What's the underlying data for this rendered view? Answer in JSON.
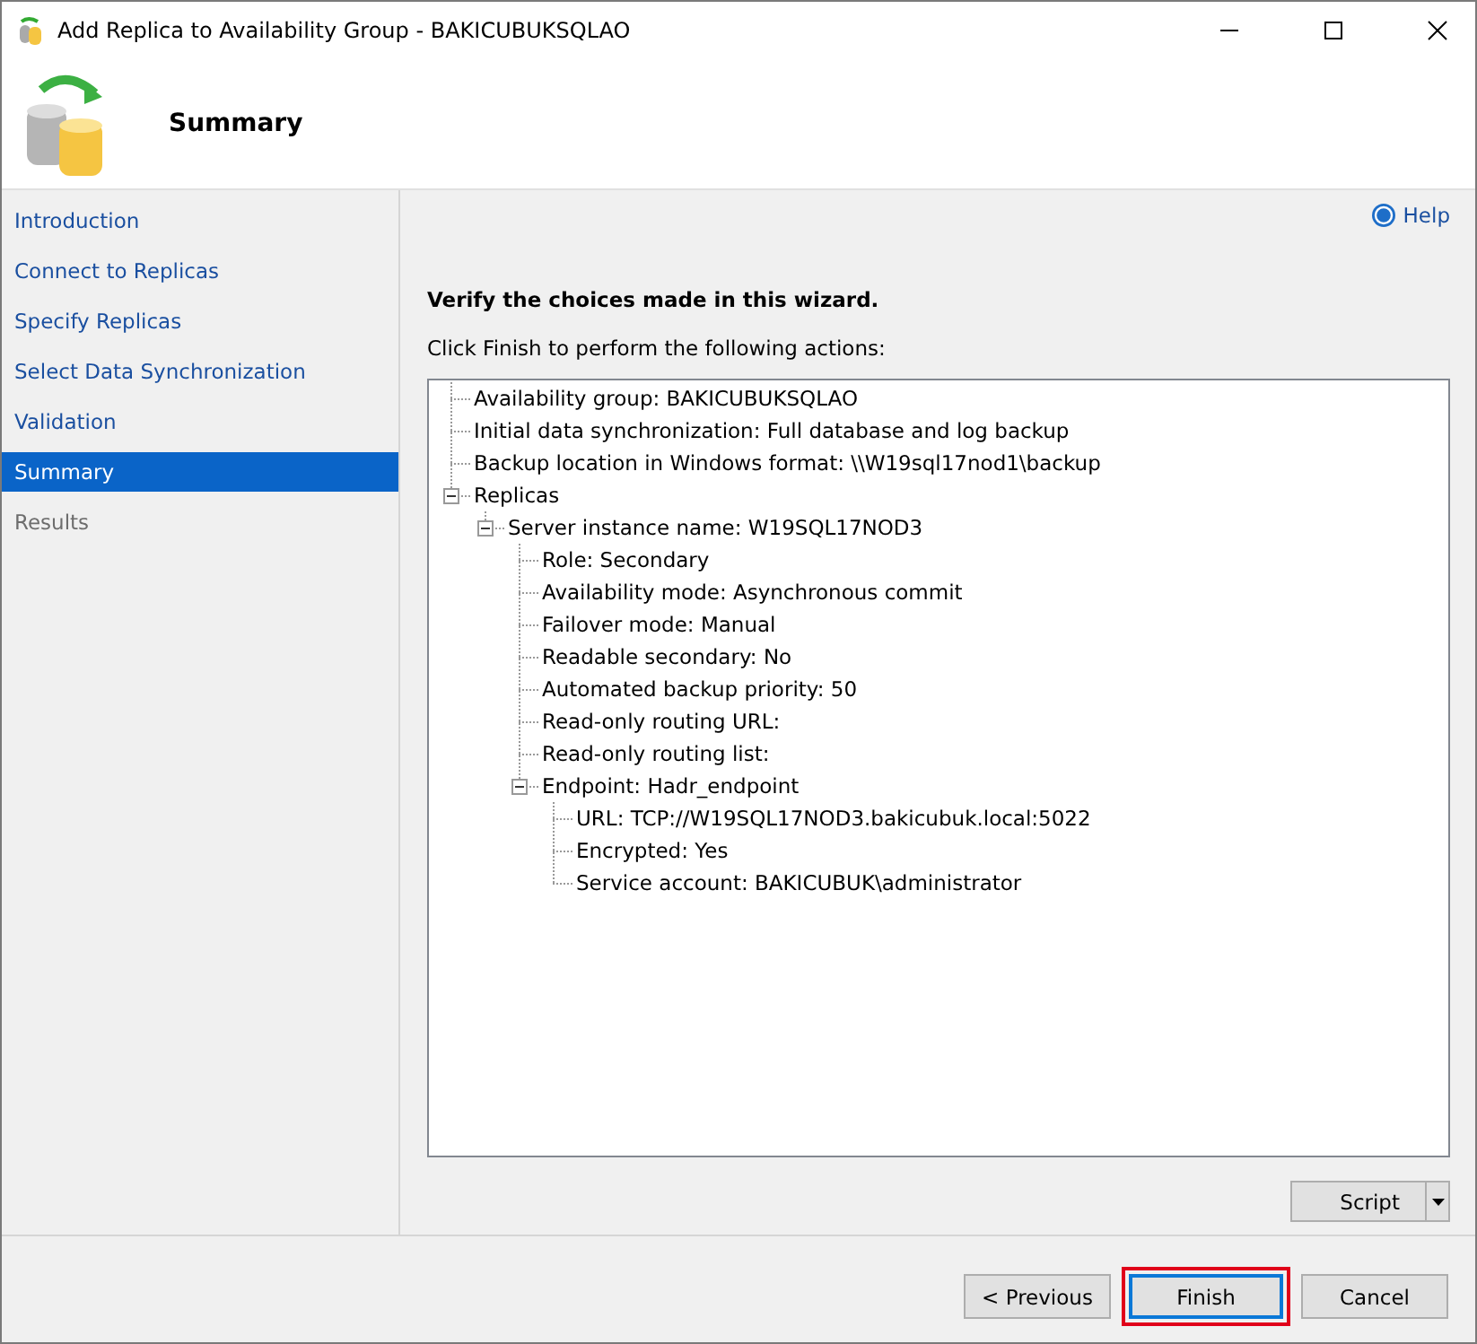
{
  "window": {
    "title": "Add Replica to Availability Group - BAKICUBUKSQLAO"
  },
  "header": {
    "title": "Summary"
  },
  "sidebar": {
    "items": [
      {
        "label": "Introduction",
        "selected": false,
        "disabled": false
      },
      {
        "label": "Connect to Replicas",
        "selected": false,
        "disabled": false
      },
      {
        "label": "Specify Replicas",
        "selected": false,
        "disabled": false
      },
      {
        "label": "Select Data Synchronization",
        "selected": false,
        "disabled": false
      },
      {
        "label": "Validation",
        "selected": false,
        "disabled": false
      },
      {
        "label": "Summary",
        "selected": true,
        "disabled": false
      },
      {
        "label": "Results",
        "selected": false,
        "disabled": true
      }
    ]
  },
  "help": {
    "label": "Help"
  },
  "heading": "Verify the choices made in this wizard.",
  "instruction": "Click Finish to perform the following actions:",
  "tree": [
    {
      "label": "Availability group: BAKICUBUKSQLAO"
    },
    {
      "label": "Initial data synchronization: Full database and log backup"
    },
    {
      "label": "Backup location in Windows format: \\\\W19sql17nod1\\backup"
    },
    {
      "label": "Replicas",
      "expanded": true,
      "children": [
        {
          "label": "Server instance name: W19SQL17NOD3",
          "expanded": true,
          "children": [
            {
              "label": "Role: Secondary"
            },
            {
              "label": "Availability mode: Asynchronous commit"
            },
            {
              "label": "Failover mode: Manual"
            },
            {
              "label": "Readable secondary: No"
            },
            {
              "label": "Automated backup priority: 50"
            },
            {
              "label": "Read-only routing URL:"
            },
            {
              "label": "Read-only routing list:"
            },
            {
              "label": "Endpoint: Hadr_endpoint",
              "expanded": true,
              "children": [
                {
                  "label": "URL: TCP://W19SQL17NOD3.bakicubuk.local:5022"
                },
                {
                  "label": "Encrypted: Yes"
                },
                {
                  "label": "Service account: BAKICUBUK\\administrator"
                }
              ]
            }
          ]
        }
      ]
    }
  ],
  "script_button": {
    "label": "Script"
  },
  "buttons": [
    {
      "label": "< Previous",
      "default": false,
      "highlighted": false
    },
    {
      "label": "Finish",
      "default": true,
      "highlighted": true
    },
    {
      "label": "Cancel",
      "default": false,
      "highlighted": false
    }
  ]
}
